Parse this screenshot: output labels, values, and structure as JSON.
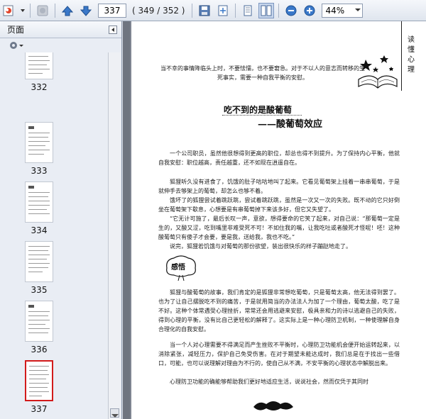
{
  "toolbar": {
    "page_current": "337",
    "page_count": "( 349 / 352 )",
    "zoom": "44%"
  },
  "panel": {
    "title": "页面"
  },
  "thumbnails": [
    {
      "label": "332"
    },
    {
      "label": "333"
    },
    {
      "label": "334"
    },
    {
      "label": "335"
    },
    {
      "label": "336"
    },
    {
      "label": "337"
    }
  ],
  "page": {
    "vertical_title": "读懂心理",
    "quote": "当不幸的事情降临头上时，不要怯懦，也不要窘急。对于不以人的意志而转移的生死事实，需要一种自我平衡的安慰。",
    "title": "吃不到的是酸葡萄",
    "subtitle": "——酸葡萄效应",
    "paragraphs": [
      "一个公司职员，虽然他很想得到更高的职位，却总也得不到提升。为了保持内心平衡，他就自我安慰：职位越高，责任越重，还不如现在逍遥自在。",
      "狐狸听久没有进食了，饥饿的肚子咕咕地叫了起来。它看见葡萄架上挂着一串串葡萄，于是就伸手去够架上的葡萄，却怎么也够不着。",
      "饿坏了的狐狸尝试着跳跃跳，尝试着跳跃跳，虽然是一次又一次的失败。既不动的它只好倒坐在葡萄架下歇息，心想要是有串葡萄掉下来该多好，但它又失望了。",
      "“它无计可施了，最后长叹一声，意欲，想得要命的它笑了起来，对自己说：“那葡萄一定是生的，又酸又涩，吃到嘴里非难受死不可！不如住我的嘴，让我吃吐或者酸死才怪呢！呸！这种酸葡萄只有傻子才会要，要是我，送给我，我也不吃。”",
      "说完，狐狸若饥饿与对葡萄的那份欲望，装出很快乐的样子蹦跶地走了。",
      "狐狸与酸葡萄的故事，我们肯定的是狐狸非常想吃葡萄，只是葡萄太高，他无法得到罢了。也为了让自己摆脱吃不到的痛苦，于是就用简当的办法法人为加了一个理由，葡萄太酸，吃了是不好。这种个体常遇受心理挫折，常常还会用逃避来安慰，极具亲和力的诗以逃避自己的失败，得到心理的平衡，没有比自己更轻松的解释了。这实际上是一种心理防卫机制，一种使理解自身合理化的自我安慰。",
      "当一个人对心理需要不得满足而产生挫败不平衡时，心理防卫功能机会便开始运转起来，以消除紧张，减轻压力，保护自己免受伤害。在对于期望未能达成时，我们总是在于找出一些借口，可能，也可以说理解对理由为不行的，使自己从不满，不安平衡的心理状态中解脱出来。",
      "心理防卫功能的确能够帮助我们更好地适应生活，说说社会，然而仅凭于其同时"
    ],
    "sketch_label": "感悟"
  }
}
